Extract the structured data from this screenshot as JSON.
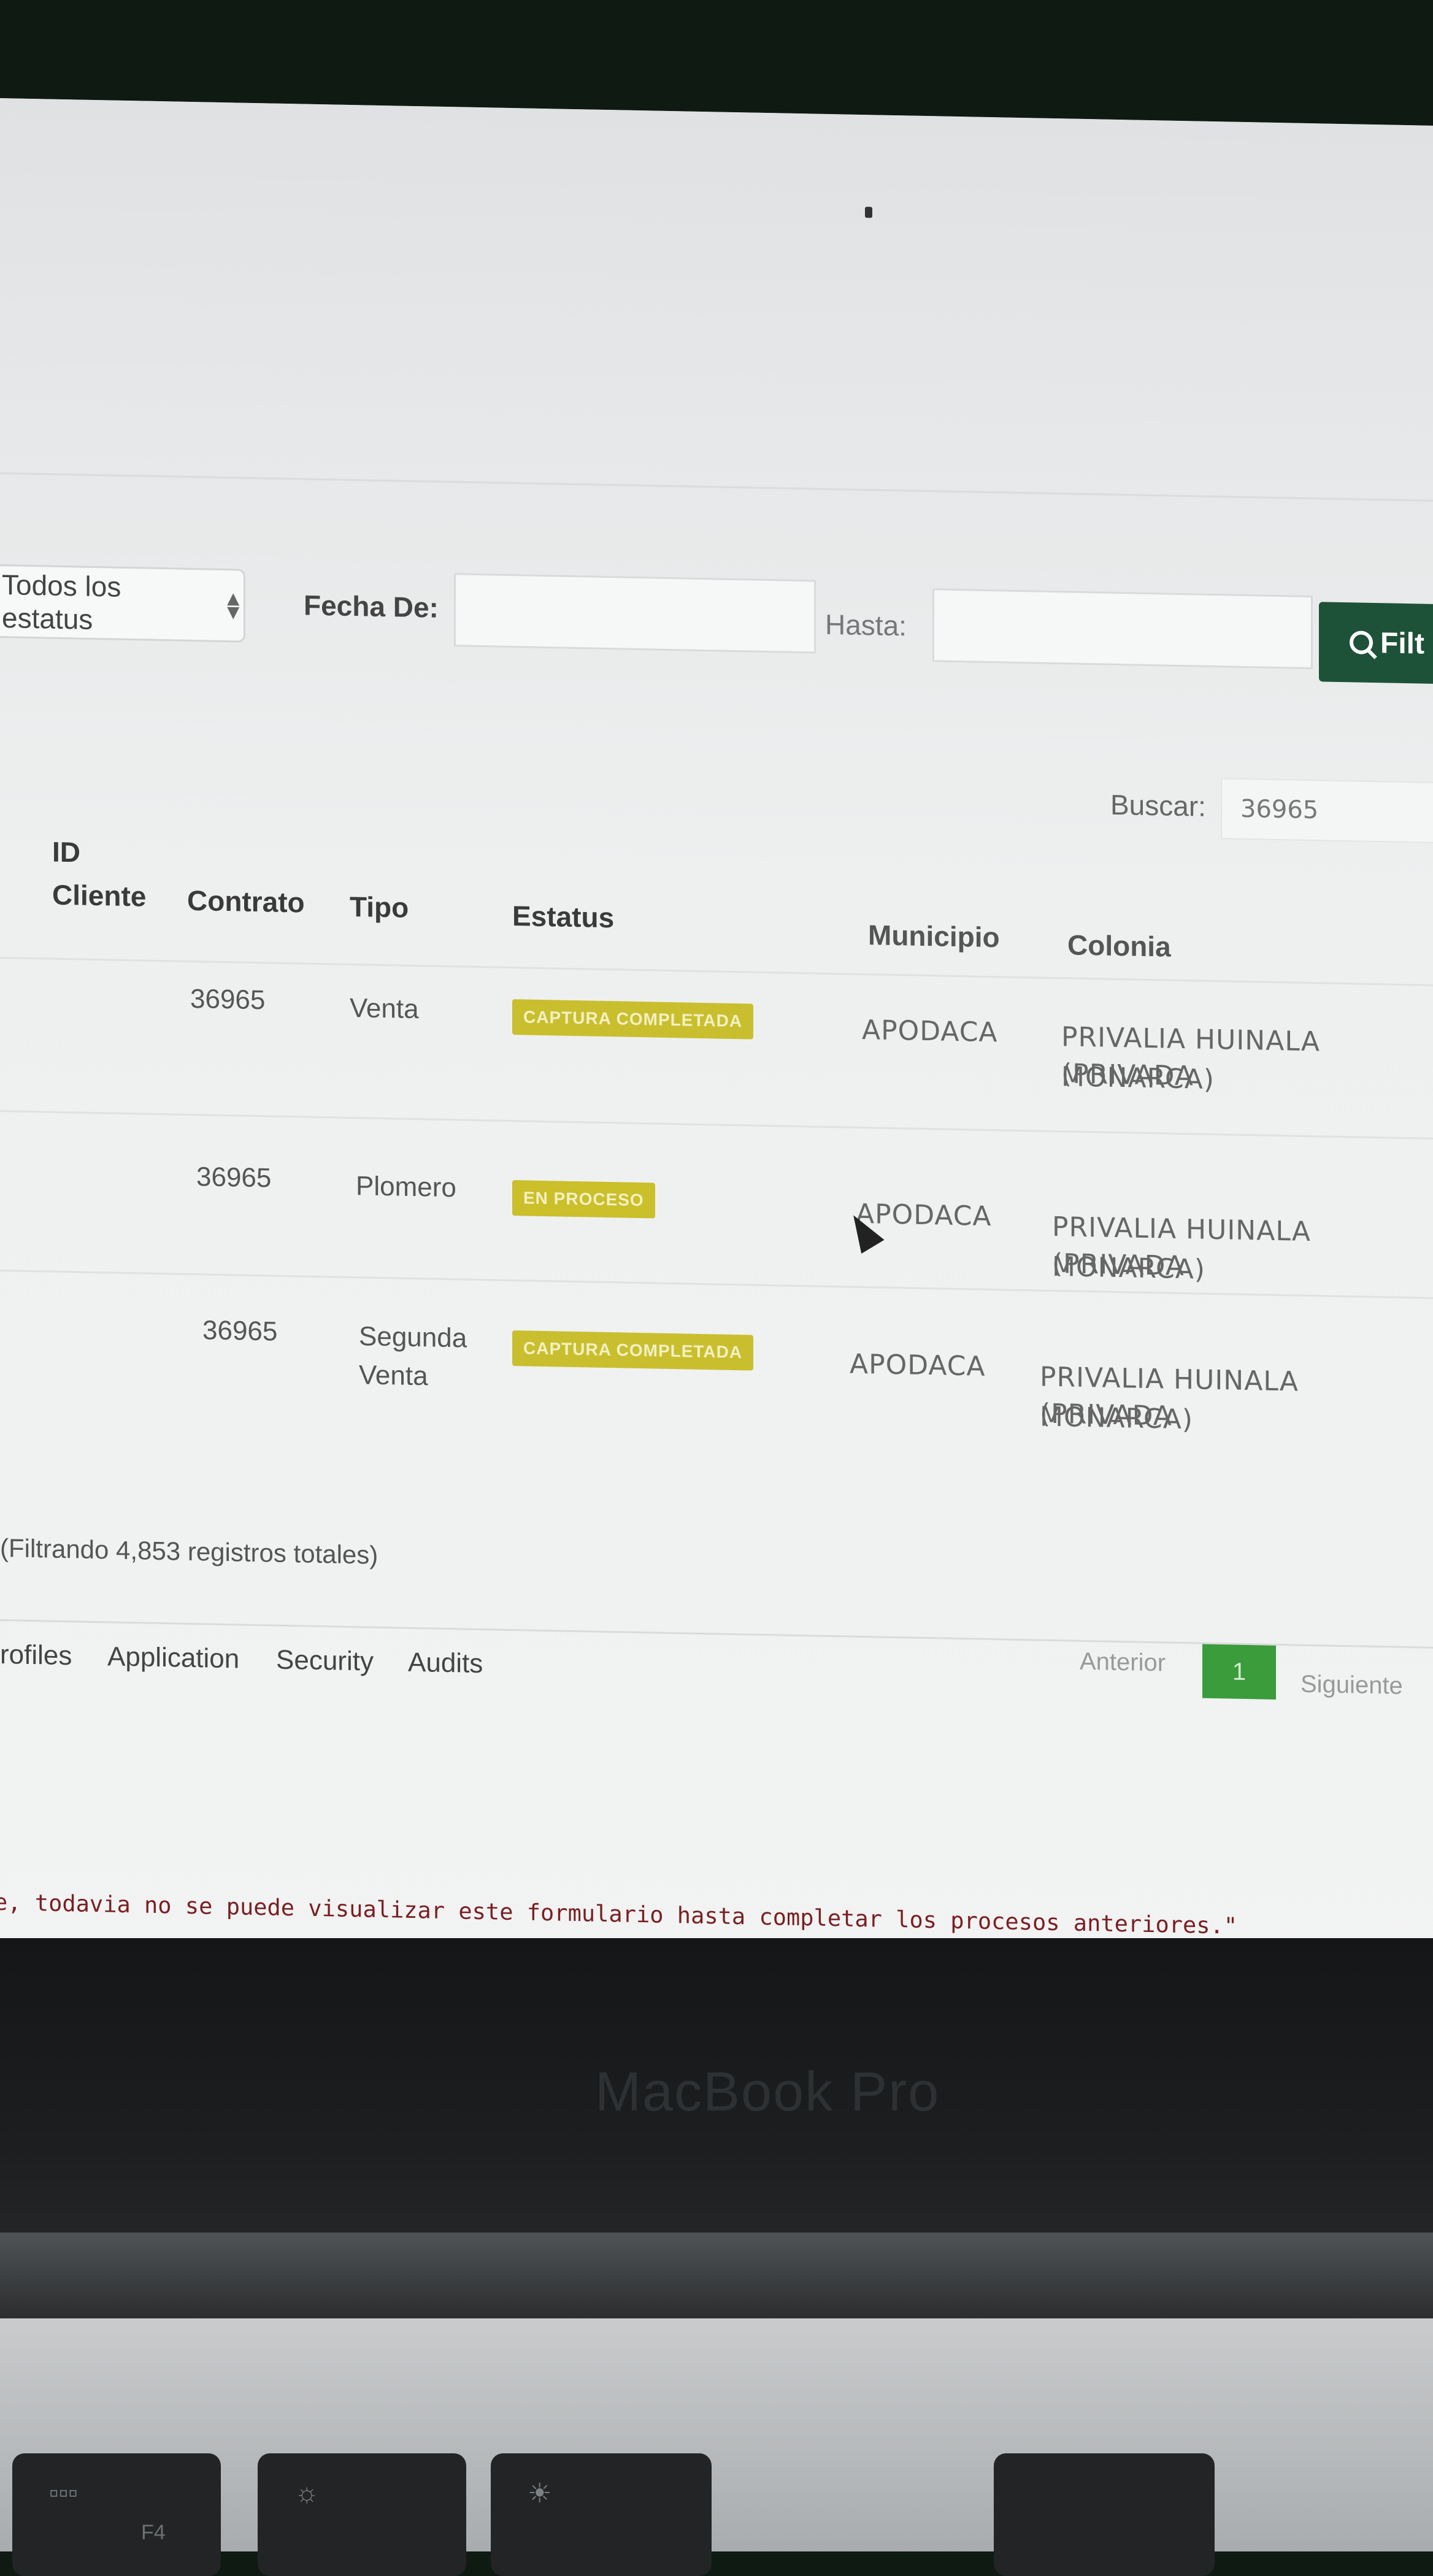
{
  "filters": {
    "status_select": "Todos los estatus",
    "date_from_label": "Fecha De:",
    "date_to_label": "Hasta:",
    "filter_button": "Filt"
  },
  "search": {
    "label": "Buscar:",
    "value": "36965"
  },
  "table": {
    "headers": {
      "id": "ID",
      "cliente": "Cliente",
      "contrato": "Contrato",
      "tipo": "Tipo",
      "estatus": "Estatus",
      "municipio": "Municipio",
      "colonia": "Colonia"
    },
    "rows": [
      {
        "contrato": "36965",
        "tipo": "Venta",
        "estatus": "CAPTURA COMPLETADA",
        "municipio": "APODACA",
        "colonia_1": "PRIVALIA HUINALA (PRIVADA",
        "colonia_2": "MONARCA)"
      },
      {
        "contrato": "36965",
        "tipo": "Plomero",
        "estatus": "EN PROCESO",
        "municipio": "APODACA",
        "colonia_1": "PRIVALIA HUINALA (PRIVADA",
        "colonia_2": "MONARCA)"
      },
      {
        "contrato": "36965",
        "tipo_1": "Segunda",
        "tipo_2": "Venta",
        "estatus": "CAPTURA COMPLETADA",
        "municipio": "APODACA",
        "colonia_1": "PRIVALIA HUINALA (PRIVADA",
        "colonia_2": "MONARCA)"
      }
    ]
  },
  "summary": "(Filtrando 4,853 registros totales)",
  "nav_tabs": [
    "rofiles",
    "Application",
    "Security",
    "Audits"
  ],
  "pagination": {
    "prev": "Anterior",
    "current": "1",
    "next": "Siguiente"
  },
  "notice": "e, todavia no se puede visualizar este formulario hasta completar los procesos anteriores.\"",
  "laptop": {
    "brand": "MacBook Pro",
    "key_f4": "F4"
  },
  "colors": {
    "filter_button": "#1d5239",
    "badge": "#c9bf2e",
    "page_active": "#3a9c3a",
    "notice_text": "#7a1f22"
  }
}
